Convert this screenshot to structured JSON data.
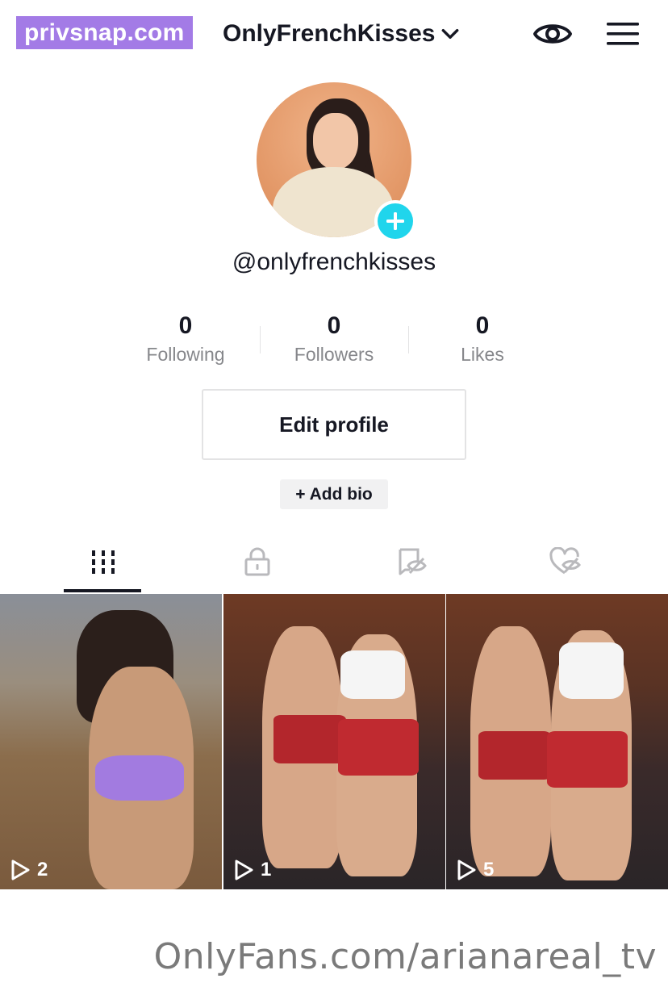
{
  "watermarks": {
    "top": "privsnap.com",
    "bottom": "OnlyFans.com/arianareal_tv"
  },
  "header": {
    "account_name": "OnlyFrenchKisses",
    "account_switch_icon": "chevron-down-icon",
    "eye_icon": "eye-icon",
    "menu_icon": "hamburger-menu-icon"
  },
  "profile": {
    "username": "@onlyfrenchkisses",
    "add_badge_color": "#20d5ec"
  },
  "stats": [
    {
      "value": "0",
      "label": "Following"
    },
    {
      "value": "0",
      "label": "Followers"
    },
    {
      "value": "0",
      "label": "Likes"
    }
  ],
  "actions": {
    "edit_profile": "Edit profile",
    "add_bio": "+ Add bio"
  },
  "tabs": [
    {
      "icon": "videos-grid-icon",
      "active": true
    },
    {
      "icon": "lock-icon",
      "active": false
    },
    {
      "icon": "tagged-eye-icon",
      "active": false
    },
    {
      "icon": "liked-heart-icon",
      "active": false
    }
  ],
  "videos": [
    {
      "plays": "2"
    },
    {
      "plays": "1"
    },
    {
      "plays": "5"
    }
  ]
}
